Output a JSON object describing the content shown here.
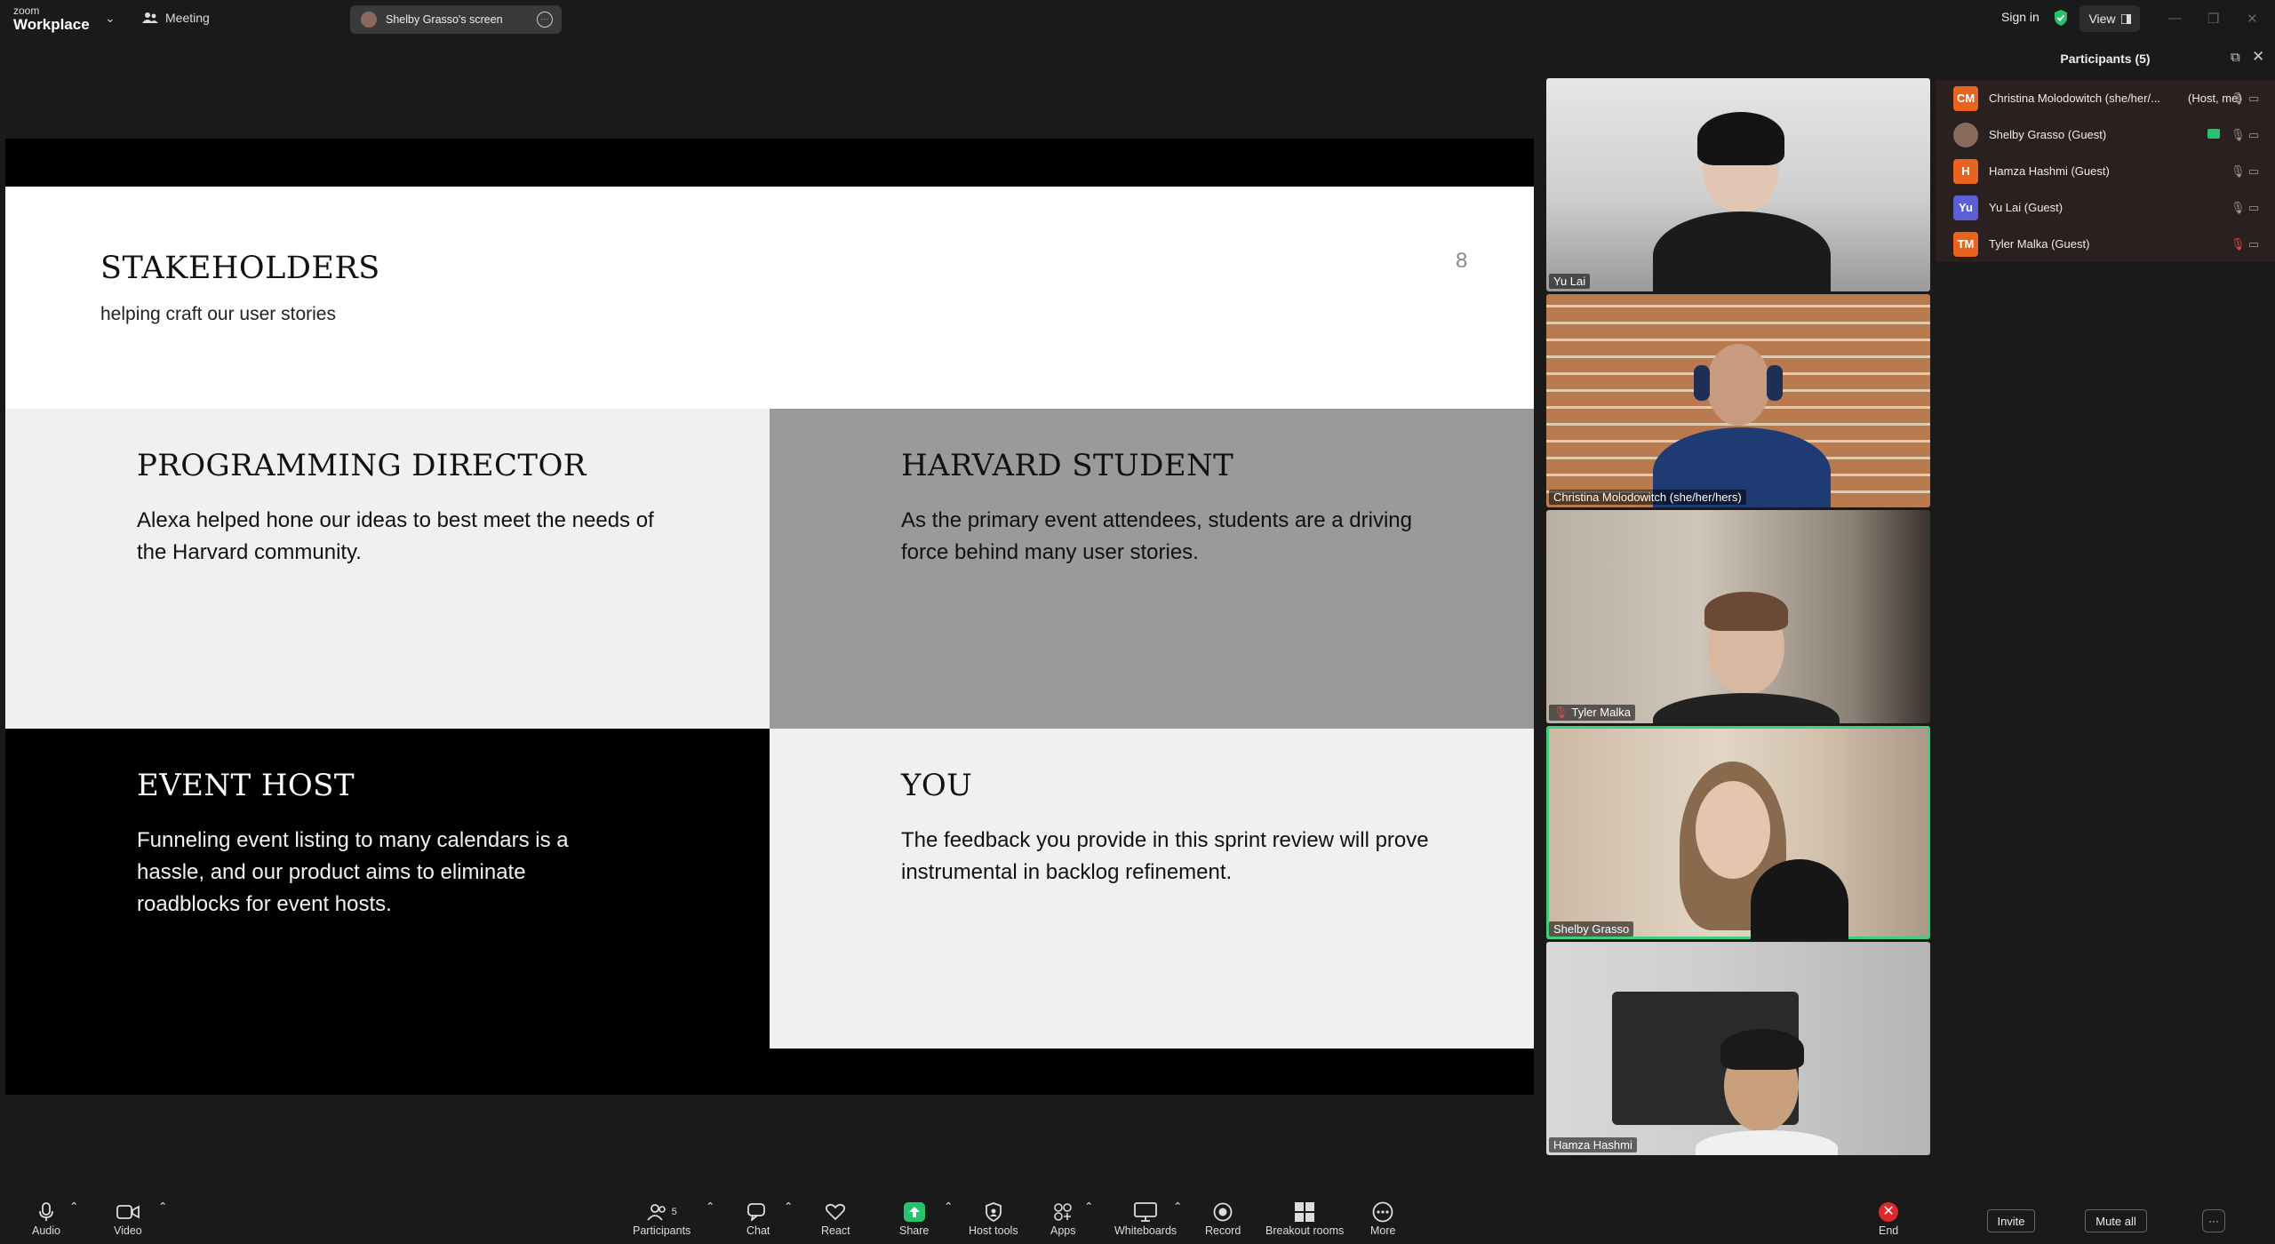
{
  "topbar": {
    "brand_small": "zoom",
    "brand_big": "Workplace",
    "meeting_label": "Meeting",
    "screen_share_label": "Shelby Grasso's screen",
    "sign_in": "Sign in",
    "view": "View"
  },
  "slide": {
    "title": "STAKEHOLDERS",
    "subtitle": "helping craft our user stories",
    "page_number": "8",
    "cells": [
      {
        "heading": "PROGRAMMING DIRECTOR",
        "text": "Alexa helped hone our ideas to best meet the needs of the Harvard community."
      },
      {
        "heading": "HARVARD STUDENT",
        "text": "As the primary event attendees, students are a driving force behind many user stories."
      },
      {
        "heading": "EVENT HOST",
        "text": "Funneling event listing to many calendars is a hassle, and our product aims to eliminate roadblocks for event hosts."
      },
      {
        "heading": "YOU",
        "text": "The feedback you provide in this sprint review will prove instrumental in backlog refinement."
      }
    ]
  },
  "videos": [
    {
      "name": "Yu Lai"
    },
    {
      "name": "Christina Molodowitch (she/her/hers)"
    },
    {
      "name": "Tyler Malka"
    },
    {
      "name": "Shelby Grasso"
    },
    {
      "name": "Hamza Hashmi"
    }
  ],
  "participants": {
    "title": "Participants (5)",
    "list": [
      {
        "initials": "CM",
        "name": "Christina Molodowitch (she/her/...",
        "role": "(Host, me)",
        "color": "#e8641e"
      },
      {
        "initials": "",
        "name": "Shelby Grasso (Guest)",
        "role": "",
        "color": "#8a6a5a"
      },
      {
        "initials": "H",
        "name": "Hamza Hashmi (Guest)",
        "role": "",
        "color": "#e8641e"
      },
      {
        "initials": "Yu",
        "name": "Yu Lai (Guest)",
        "role": "",
        "color": "#5c5fd6"
      },
      {
        "initials": "TM",
        "name": "Tyler Malka (Guest)",
        "role": "",
        "color": "#e8641e"
      }
    ],
    "invite": "Invite",
    "mute_all": "Mute all"
  },
  "toolbar": {
    "audio": "Audio",
    "video": "Video",
    "participants": "Participants",
    "participants_count": "5",
    "chat": "Chat",
    "react": "React",
    "share": "Share",
    "host_tools": "Host tools",
    "apps": "Apps",
    "whiteboards": "Whiteboards",
    "record": "Record",
    "breakout_rooms": "Breakout rooms",
    "more": "More",
    "end": "End"
  }
}
